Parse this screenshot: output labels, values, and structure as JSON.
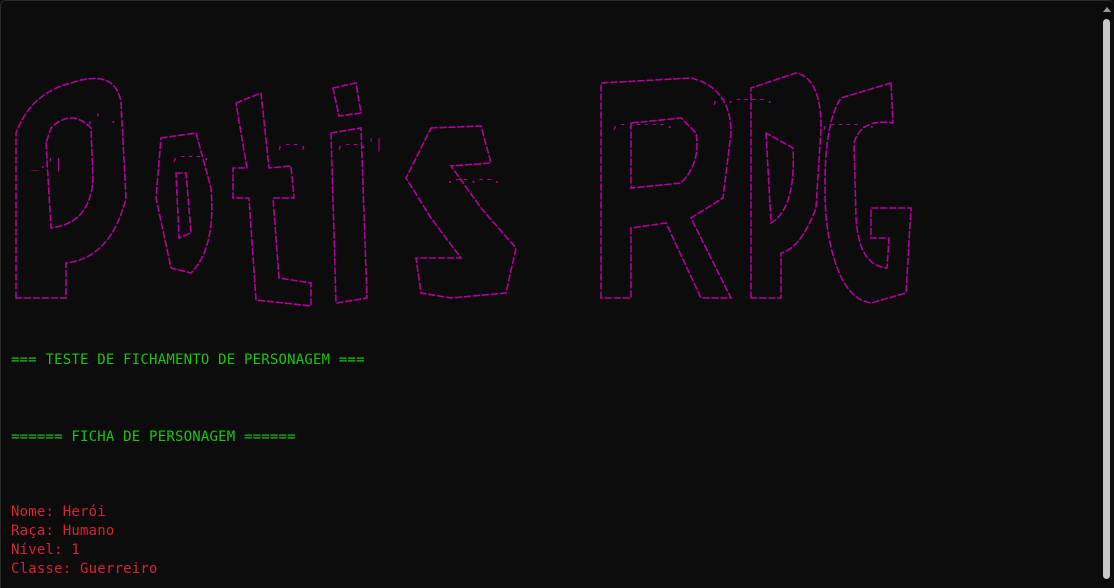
{
  "banner": {
    "ascii_art_text": "Potis RPG",
    "color": "#b4009e"
  },
  "output": {
    "header_test": "=== TESTE DE FICHAMENTO DE PERSONAGEM ===",
    "header_sheet": "====== FICHA DE PERSONAGEM ======",
    "fields": [
      {
        "text": "Nome: Herói"
      },
      {
        "text": "Raça: Humano"
      },
      {
        "text": "Nível: 1"
      },
      {
        "text": "Classe: Guerreiro"
      }
    ]
  },
  "colors": {
    "background": "#0c0c0c",
    "green": "#16c60c",
    "red": "#d8242f",
    "magenta": "#b4009e"
  }
}
